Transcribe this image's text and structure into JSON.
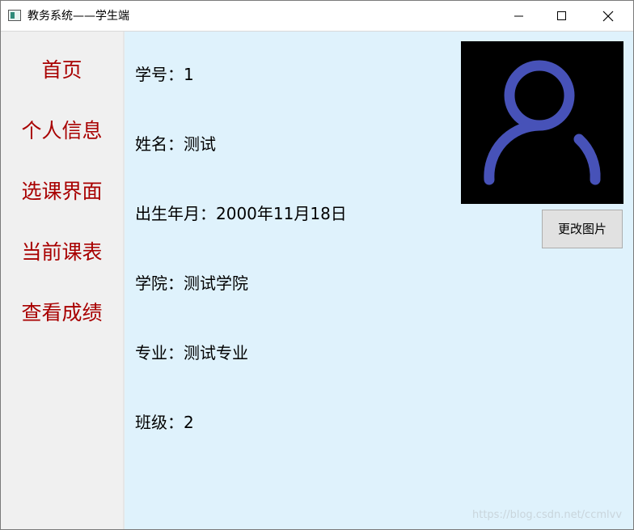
{
  "window": {
    "title": "教务系统——学生端",
    "icons": {
      "app": "app-icon",
      "minimize": "minimize-icon",
      "maximize": "maximize-icon",
      "close": "close-icon"
    }
  },
  "sidebar": {
    "items": [
      {
        "label": "首页"
      },
      {
        "label": "个人信息"
      },
      {
        "label": "选课界面"
      },
      {
        "label": "当前课表"
      },
      {
        "label": "查看成绩"
      }
    ]
  },
  "profile": {
    "student_id": "学号：1",
    "name": "姓名：测试",
    "birth": "出生年月：2000年11月18日",
    "college": "学院：测试学院",
    "major": "专业：测试专业",
    "class": "班级：2"
  },
  "avatar": {
    "icon": "user-avatar-icon",
    "color": "#4752b8",
    "background": "#000000"
  },
  "actions": {
    "change_image": "更改图片"
  },
  "watermark": "https://blog.csdn.net/ccmlvv",
  "colors": {
    "nav_text": "#a80000",
    "content_bg": "#dff2fc",
    "sidebar_bg": "#f0f0f0"
  }
}
